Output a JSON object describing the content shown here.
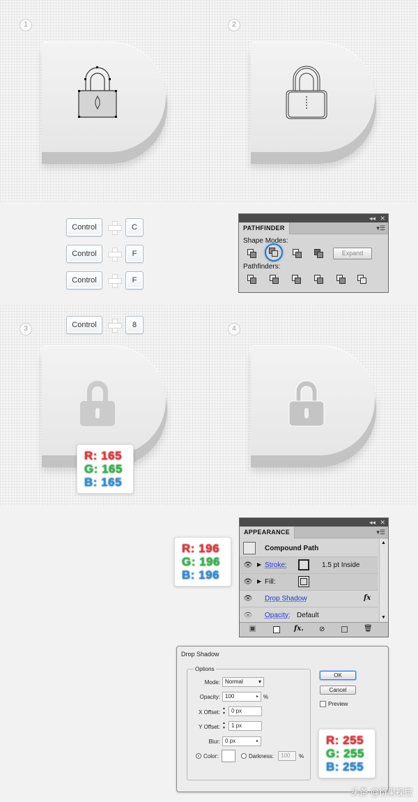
{
  "steps": [
    "1",
    "2",
    "3",
    "4"
  ],
  "shortcuts": [
    {
      "modifier": "Control",
      "key": "C"
    },
    {
      "modifier": "Control",
      "key": "F"
    },
    {
      "modifier": "Control",
      "key": "F"
    },
    {
      "modifier": "Control",
      "key": "8"
    }
  ],
  "pathfinder": {
    "title": "PATHFINDER",
    "shape_modes_label": "Shape Modes:",
    "pathfinders_label": "Pathfinders:",
    "expand_label": "Expand"
  },
  "color_swatches": [
    {
      "r": "R: 165",
      "g": "G: 165",
      "b": "B: 165"
    },
    {
      "r": "R: 196",
      "g": "G: 196",
      "b": "B: 196"
    },
    {
      "r": "R: 255",
      "g": "G: 255",
      "b": "B: 255"
    }
  ],
  "appearance": {
    "title": "APPEARANCE",
    "object_label": "Compound Path",
    "rows": [
      {
        "label": "Stroke:",
        "value": "1.5 pt  Inside"
      },
      {
        "label": "Fill:",
        "value": ""
      },
      {
        "label": "Drop Shadow",
        "value": "fx"
      },
      {
        "label": "Opacity:",
        "value": "Default"
      }
    ],
    "fx_label": "fx."
  },
  "drop_shadow": {
    "title": "Drop Shadow",
    "options_label": "Options",
    "mode_label": "Mode:",
    "mode_value": "Normal",
    "opacity_label": "Opacity:",
    "opacity_value": "100",
    "opacity_unit": "%",
    "x_label": "X Offset:",
    "x_value": "0 px",
    "y_label": "Y Offset:",
    "y_value": "1 px",
    "blur_label": "Blur:",
    "blur_value": "0 px",
    "color_label": "Color:",
    "darkness_label": "Darkness:",
    "darkness_value": "100",
    "darkness_unit": "%",
    "ok_label": "OK",
    "cancel_label": "Cancel",
    "preview_label": "Preview"
  },
  "watermark": "头条 @衍果视觉"
}
